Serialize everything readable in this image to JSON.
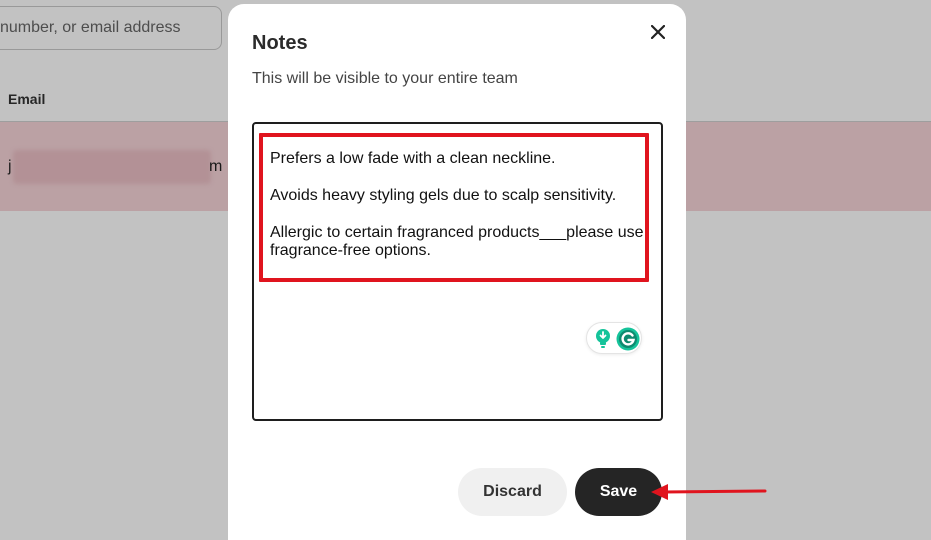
{
  "background": {
    "search": {
      "placeholder": "number, or email address"
    },
    "table": {
      "column_header": "Email",
      "row": {
        "email_start": "j",
        "email_end": "m"
      }
    }
  },
  "modal": {
    "title": "Notes",
    "subtitle": "This will be visible to your entire team",
    "notes": [
      "Prefers a low fade with a clean neckline.",
      "Avoids heavy styling gels due to scalp sensitivity.",
      "Allergic to certain fragranced products___please use fragrance-free options."
    ],
    "buttons": {
      "discard": "Discard",
      "save": "Save"
    }
  },
  "colors": {
    "overlay": "#0000003d",
    "highlight": "#e0141e",
    "save_button": "#252525",
    "discard_button": "#f0f0f0",
    "row_highlight": "#f6d4d8",
    "grammarly": "#15c39a"
  },
  "icons": {
    "close": "close-icon",
    "grammarly_suggestion": "lightbulb-icon",
    "grammarly_logo": "grammarly-g-icon",
    "annotation_arrow": "arrow-left-icon"
  }
}
